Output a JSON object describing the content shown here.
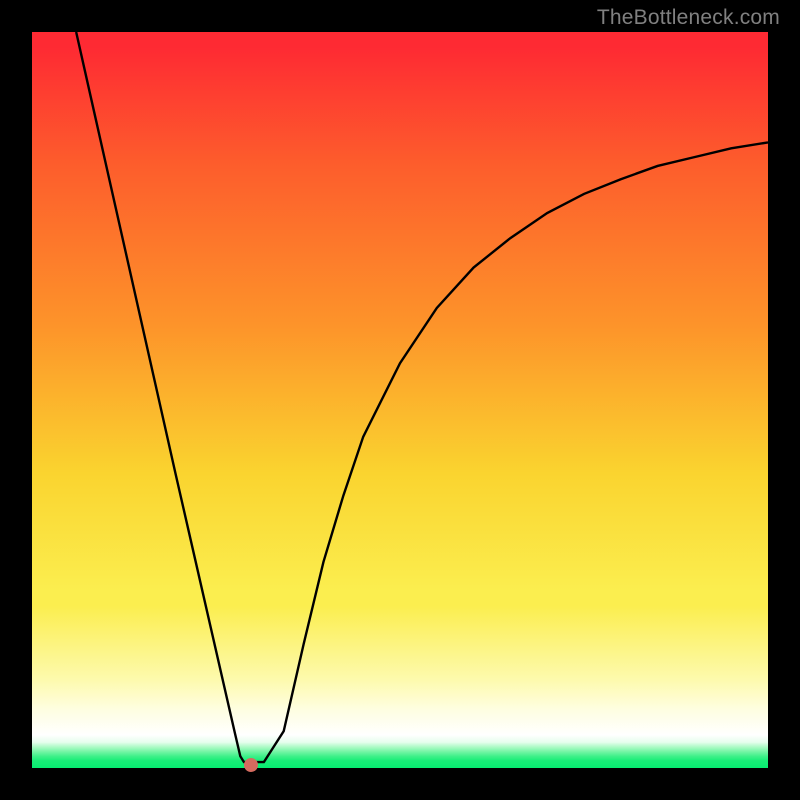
{
  "watermark": {
    "text": "TheBottleneck.com"
  },
  "colors": {
    "background": "#000000",
    "gradient_top": "#fe2a33",
    "gradient_bottom": "#07ed71",
    "curve": "#000000",
    "marker": "#d56b5f",
    "watermark": "#808080"
  },
  "chart_data": {
    "type": "line",
    "title": "",
    "xlabel": "",
    "ylabel": "",
    "xlim": [
      0,
      1
    ],
    "ylim": [
      0,
      1
    ],
    "marker": {
      "x": 0.298,
      "y": 0.004
    },
    "series": [
      {
        "name": "curve",
        "x": [
          0.06,
          0.087,
          0.114,
          0.141,
          0.168,
          0.195,
          0.222,
          0.249,
          0.276,
          0.283,
          0.288,
          0.315,
          0.342,
          0.369,
          0.396,
          0.423,
          0.45,
          0.5,
          0.55,
          0.6,
          0.65,
          0.7,
          0.75,
          0.8,
          0.85,
          0.9,
          0.95,
          1.0
        ],
        "y": [
          1.0,
          0.88,
          0.76,
          0.64,
          0.52,
          0.4,
          0.282,
          0.164,
          0.046,
          0.016,
          0.008,
          0.008,
          0.05,
          0.168,
          0.28,
          0.37,
          0.45,
          0.55,
          0.625,
          0.68,
          0.72,
          0.754,
          0.78,
          0.8,
          0.818,
          0.83,
          0.842,
          0.85
        ]
      }
    ]
  }
}
